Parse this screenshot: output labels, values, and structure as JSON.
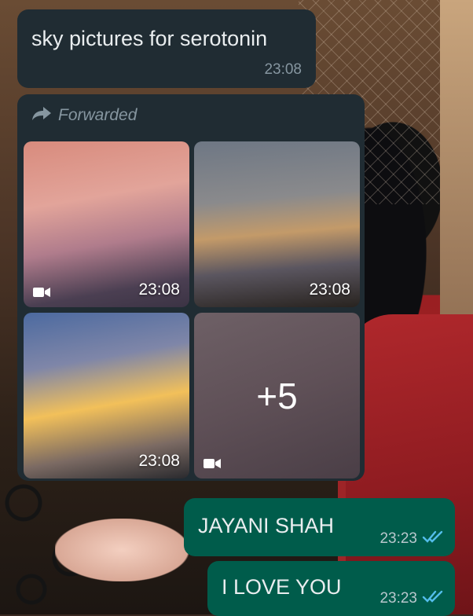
{
  "messages": [
    {
      "text": "sky pictures for serotonin",
      "time": "23:08"
    },
    {
      "forwarded_label": "Forwarded",
      "media": [
        {
          "time": "23:08",
          "type": "video"
        },
        {
          "time": "23:08",
          "type": "image"
        },
        {
          "time": "23:08",
          "type": "image"
        },
        {
          "overflow": "+5",
          "type": "video"
        }
      ]
    },
    {
      "text": "JAYANI SHAH",
      "time": "23:23",
      "status": "read"
    },
    {
      "text": "I LOVE YOU",
      "time": "23:23",
      "status": "read"
    }
  ],
  "colors": {
    "incoming_bubble": "#202c33",
    "outgoing_bubble": "#005c4b",
    "read_ticks": "#53bdeb"
  }
}
